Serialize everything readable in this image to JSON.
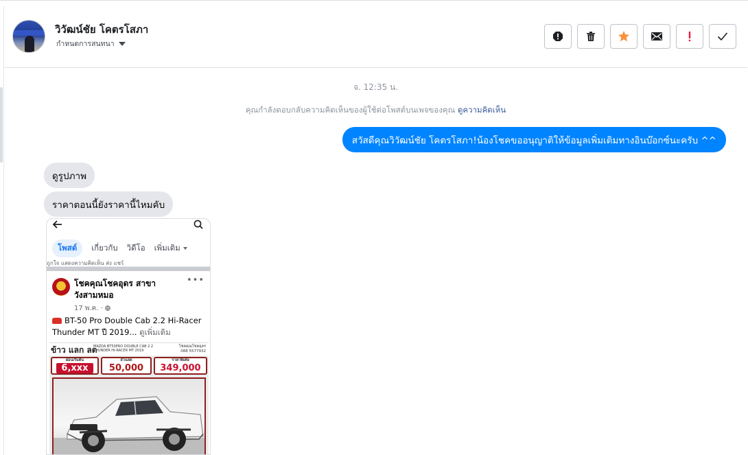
{
  "header": {
    "contact_name": "วิวัฒน์ชัย โคตรโสภา",
    "conversation_action": "กำหนดการสนทนา",
    "toolbar": [
      {
        "name": "report-icon",
        "label": "Report"
      },
      {
        "name": "trash-icon",
        "label": "Delete"
      },
      {
        "name": "star-icon",
        "label": "Star"
      },
      {
        "name": "mail-icon",
        "label": "Mark unread"
      },
      {
        "name": "exclamation-icon",
        "label": "Spam"
      },
      {
        "name": "check-icon",
        "label": "Done"
      }
    ]
  },
  "colors": {
    "outgoing_bubble": "#0084ff",
    "incoming_bubble": "#e4e6eb",
    "star": "#f7923b",
    "spam": "#e41e3f",
    "link": "#385898"
  },
  "thread": {
    "timestamp": "จ. 12:35 น.",
    "system_note": "คุณกำลังตอบกลับความคิดเห็นของผู้ใช้ต่อโพสต์บนเพจของคุณ",
    "system_note_link": "ดูความคิดเห็น",
    "outgoing_message": "สวัสดีคุณวิวัฒน์ชัย โคตรโสภา!น้องโชคขออนุญาติให้ข้อมูลเพิ่มเติมทางอินบ๊อกซ์นะครับ ^^",
    "incoming_messages": [
      "ดูรูปภาพ",
      "ราคาตอนนี้ยังราคานี้ไหมคับ"
    ]
  },
  "shared_image": {
    "tabs": [
      "โพสต์",
      "เกี่ยวกับ",
      "วิดีโอ",
      "เพิ่มเติม"
    ],
    "strip_text": "ถูกใจ   แสดงความคิดเห็น   ส่ง   แชร์",
    "page_name": "โชคคุณโชคอุดร สาขา วังสามหมอ",
    "post_date": "17 พ.ค. · ",
    "post_text": "BT-50 Pro Double Cab 2.2 Hi-Racer Thunder MT ปี 2019...",
    "see_more": "ดูเพิ่มเติม",
    "ad": {
      "headline": "ข้าว แลก ลด",
      "model_text": "MAZDA BT50PRO DOUBLE CAB 2.2 THUNDER HI-RACER MT 2019",
      "dealer_name": "โชคคุณโชคอุดร",
      "dealer_phone": "088 5577932",
      "installment_caption": "ผ่อนเริ่มต้น",
      "installment_value": "6,xxx",
      "discount_caption": "ส่วนลด",
      "discount_value": "50,000",
      "price_caption": "ราคาพิเศษ",
      "price_value": "349,000"
    }
  }
}
